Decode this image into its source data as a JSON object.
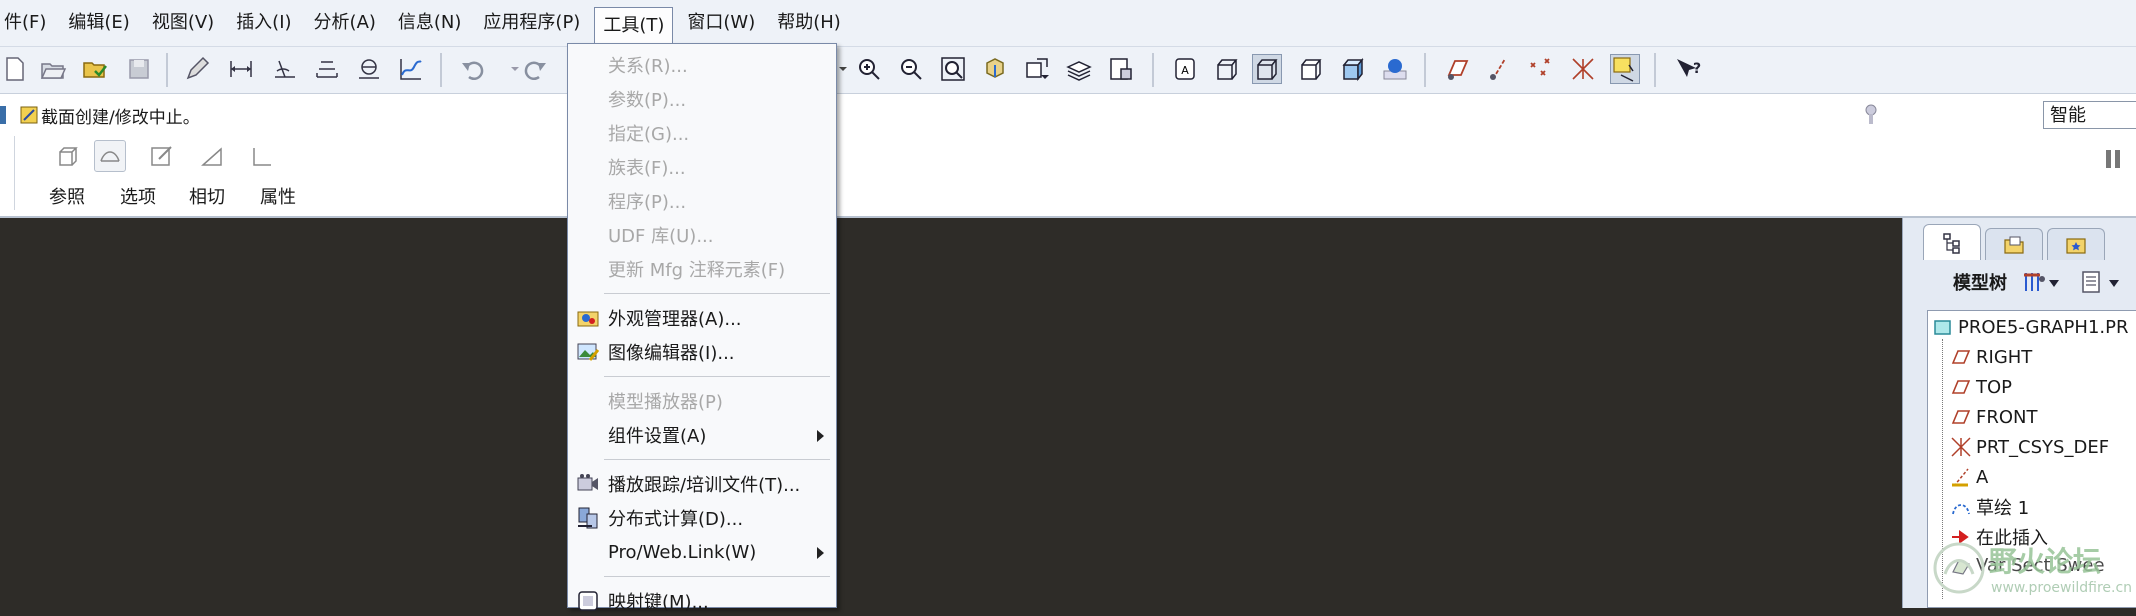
{
  "menubar": {
    "items": [
      "件(F)",
      "编辑(E)",
      "视图(V)",
      "插入(I)",
      "分析(A)",
      "信息(N)",
      "应用程序(P)",
      "工具(T)",
      "窗口(W)",
      "帮助(H)"
    ],
    "active_index": 7
  },
  "dashboard": {
    "status_message": "截面创建/修改中止。",
    "tabs": [
      "参照",
      "选项",
      "相切",
      "属性"
    ],
    "filter_value": "智能"
  },
  "tools_menu": {
    "items": [
      {
        "label": "关系(R)...",
        "enabled": false
      },
      {
        "label": "参数(P)...",
        "enabled": false
      },
      {
        "label": "指定(G)...",
        "enabled": false
      },
      {
        "label": "族表(F)...",
        "enabled": false
      },
      {
        "label": "程序(P)...",
        "enabled": false
      },
      {
        "label": "UDF 库(U)...",
        "enabled": false
      },
      {
        "label": "更新 Mfg 注释元素(F)",
        "enabled": false
      },
      {
        "label": "外观管理器(A)...",
        "enabled": true,
        "icon": "appearance-icon"
      },
      {
        "label": "图像编辑器(I)...",
        "enabled": true,
        "icon": "image-editor-icon"
      },
      {
        "label": "模型播放器(P)",
        "enabled": false
      },
      {
        "label": "组件设置(A)",
        "enabled": true,
        "submenu": true
      },
      {
        "label": "播放跟踪/培训文件(T)...",
        "enabled": true,
        "icon": "trail-file-icon"
      },
      {
        "label": "分布式计算(D)...",
        "enabled": true,
        "icon": "distributed-computing-icon"
      },
      {
        "label": "Pro/Web.Link(W)",
        "enabled": true,
        "submenu": true
      },
      {
        "label": "映射键(M)...",
        "enabled": true,
        "icon": "mapkey-icon"
      }
    ]
  },
  "model_tree": {
    "title": "模型树",
    "root": "PROE5-GRAPH1.PR",
    "items": [
      {
        "label": "RIGHT",
        "icon": "datum-plane-icon"
      },
      {
        "label": "TOP",
        "icon": "datum-plane-icon"
      },
      {
        "label": "FRONT",
        "icon": "datum-plane-icon"
      },
      {
        "label": "PRT_CSYS_DEF",
        "icon": "csys-icon"
      },
      {
        "label": "A",
        "icon": "datum-axis-icon"
      },
      {
        "label": "草绘 1",
        "icon": "sketch-icon"
      },
      {
        "label": "在此插入",
        "icon": "insert-here-icon"
      },
      {
        "label": "Var Sect Swee",
        "icon": "sweep-icon"
      }
    ]
  },
  "watermark": {
    "text": "野火论坛",
    "url": "www.proewildfire.cn"
  },
  "colors": {
    "viewport_bg": "#2e2c28",
    "chrome_bg": "#eef2f8",
    "accent": "#3a6ea8"
  }
}
